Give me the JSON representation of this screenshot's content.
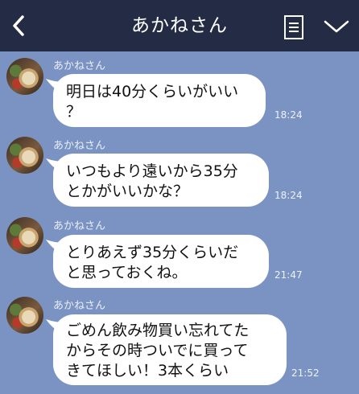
{
  "header": {
    "title": "あかねさん"
  },
  "messages": [
    {
      "sender": "あかねさん",
      "text": "明日は40分くらいがいい\n？",
      "time": "18:24"
    },
    {
      "sender": "あかねさん",
      "text": "いつもより遠いから35分\nとかがいいかな？",
      "time": "18:24"
    },
    {
      "sender": "あかねさん",
      "text": "とりあえず35分くらいだ\nと思っておくね。",
      "time": "21:47"
    },
    {
      "sender": "あかねさん",
      "text": "ごめん飲み物買い忘れてた\nからその時ついでに買って\nきてほしい！3本くらい",
      "time": "21:52"
    }
  ]
}
